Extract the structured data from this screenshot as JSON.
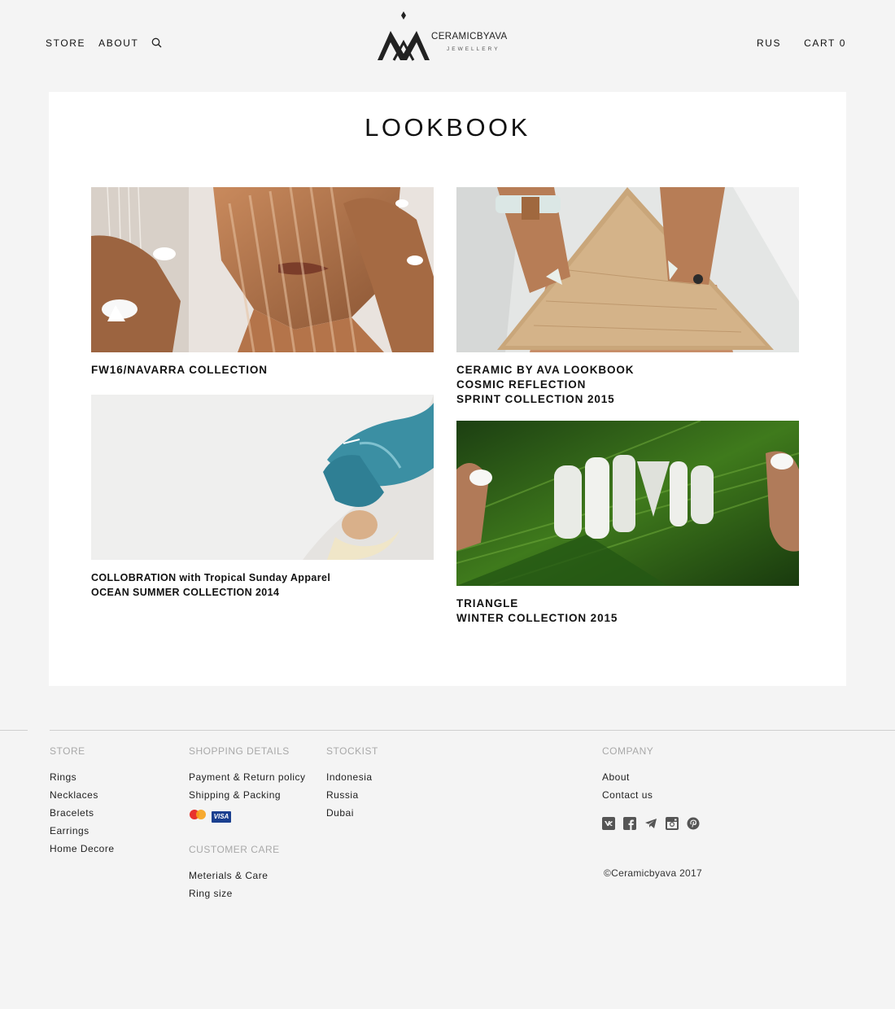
{
  "header": {
    "nav_left": [
      "STORE",
      "ABOUT"
    ],
    "logo": {
      "name": "CERAMICBYAVA",
      "subtitle": "JEWELLERY"
    },
    "language": "RUS",
    "cart_label": "CART",
    "cart_count": "0"
  },
  "main": {
    "title": "LOOKBOOK",
    "items": [
      {
        "caption_lines": [
          "FW16/NAVARRA COLLECTION"
        ]
      },
      {
        "caption_lines": [
          "CERAMIC BY AVA LOOKBOOK",
          "COSMIC REFLECTION",
          "SPRINT COLLECTION 2015"
        ]
      },
      {
        "caption_lines": [
          "COLLOBRATION with Tropical Sunday Apparel",
          "OCEAN SUMMER COLLECTION 2014"
        ]
      },
      {
        "caption_lines": [
          "TRIANGLE",
          "WINTER COLLECTION 2015"
        ]
      }
    ]
  },
  "footer": {
    "store": {
      "heading": "STORE",
      "links": [
        "Rings",
        "Necklaces",
        "Bracelets",
        "Earrings",
        "Home Decore"
      ]
    },
    "shopping": {
      "heading": "SHOPPING DETAILS",
      "links": [
        "Payment & Return policy",
        "Shipping & Packing"
      ]
    },
    "payment_icons": [
      "mastercard-icon",
      "visa-icon"
    ],
    "visa_label": "VISA",
    "care": {
      "heading": "CUSTOMER CARE",
      "links": [
        "Meterials & Care",
        "Ring size"
      ]
    },
    "stockist": {
      "heading": "STOCKIST",
      "links": [
        "Indonesia",
        "Russia",
        "Dubai"
      ]
    },
    "company": {
      "heading": "COMPANY",
      "links": [
        "About",
        "Contact us"
      ]
    },
    "social_icons": [
      "vk-icon",
      "facebook-icon",
      "telegram-icon",
      "instagram-icon",
      "pinterest-icon"
    ],
    "copyright": "©Ceramicbyava 2017"
  }
}
